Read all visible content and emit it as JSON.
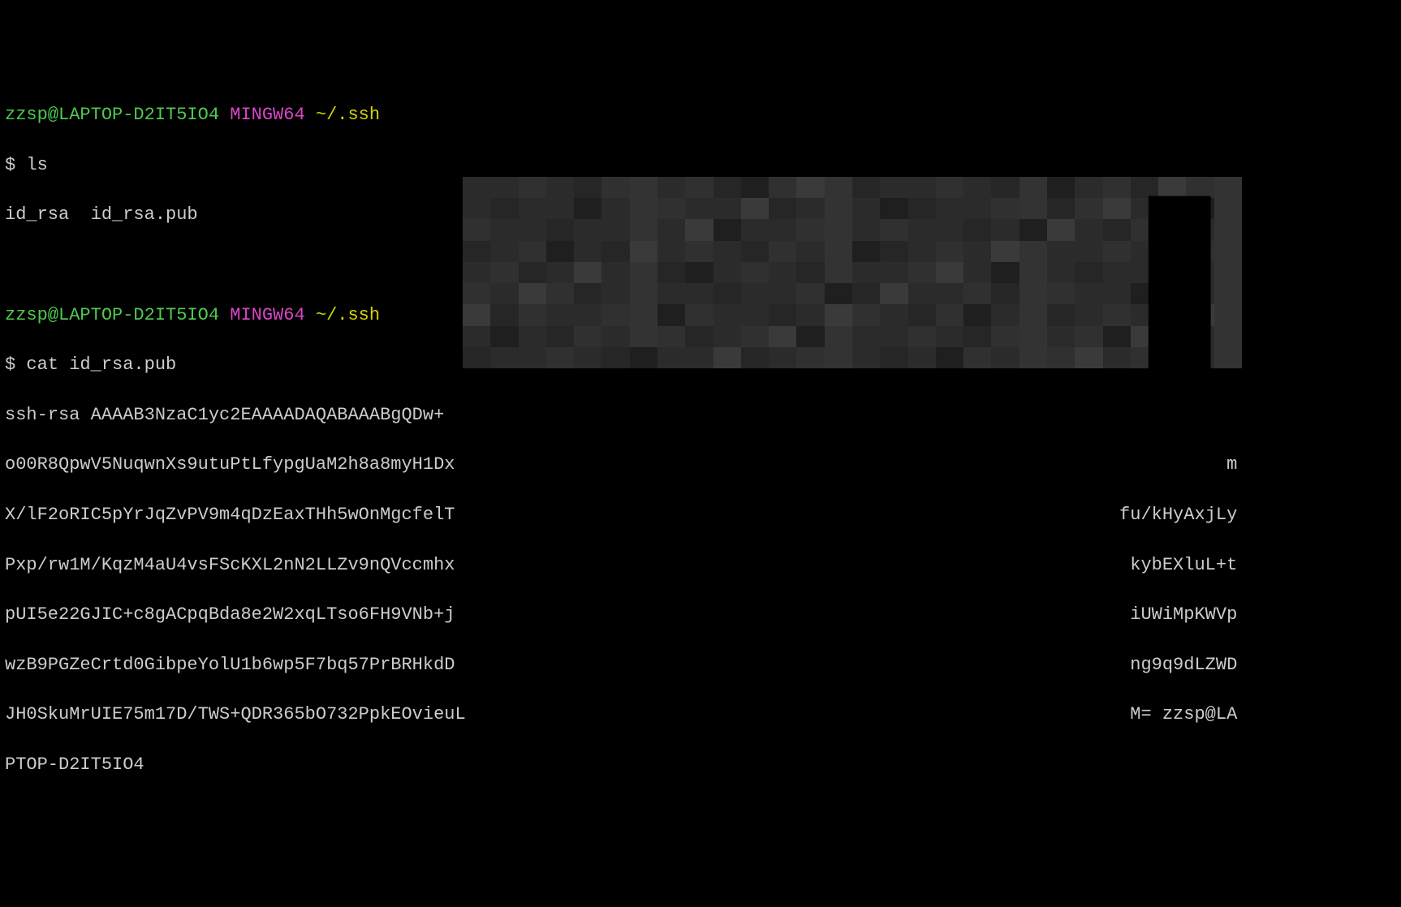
{
  "prompt1": {
    "user_host": "zzsp@LAPTOP-D2IT5IO4",
    "system": "MINGW64",
    "path": "~/.ssh"
  },
  "command1": {
    "symbol": "$",
    "text": "ls"
  },
  "output1": "id_rsa  id_rsa.pub",
  "prompt2": {
    "user_host": "zzsp@LAPTOP-D2IT5IO4",
    "system": "MINGW64",
    "path": "~/.ssh"
  },
  "command2": {
    "symbol": "$",
    "text": "cat id_rsa.pub"
  },
  "output2_lines": {
    "l1a": "ssh-rsa AAAAB3NzaC1yc2EAAAADAQABAAABgQDw+",
    "l2a": "o00R8QpwV5NuqwnXs9utuPtLfypgUaM2h8a8myH1Dx",
    "l2b": "m",
    "l3a": "X/lF2oRIC5pYrJqZvPV9m4qDzEaxTHh5wOnMgcfelT",
    "l3b": "fu/kHyAxjLy",
    "l4a": "Pxp/rw1M/KqzM4aU4vsFScKXL2nN2LLZv9nQVccmhx",
    "l4b": "kybEXluL+t",
    "l5a": "pUI5e22GJIC+c8gACpqBda8e2W2xqLTso6FH9VNb+j",
    "l5b": "iUWiMpKWVp",
    "l6a": "wzB9PGZeCrtd0GibpeYolU1b6wp5F7bq57PrBRHkdD",
    "l6b": "ng9q9dLZWD",
    "l7a": "JH0SkuMrUIE75m17D/TWS+QDR365bO732PpkEOvieuL",
    "l7b": "M= zzsp@LA",
    "l8": "PTOP-D2IT5IO4"
  }
}
